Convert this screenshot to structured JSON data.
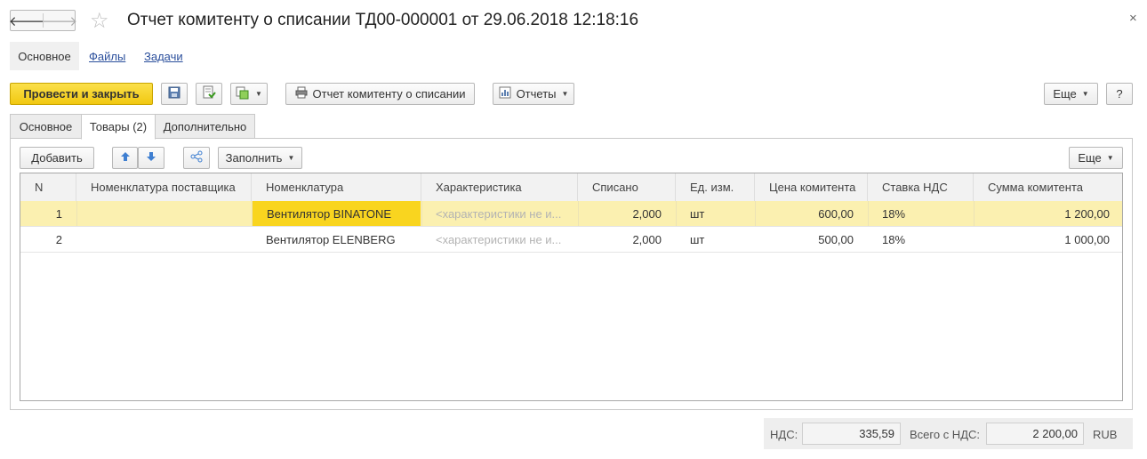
{
  "window": {
    "title": "Отчет комитенту о списании ТД00-000001 от 29.06.2018 12:18:16",
    "back_glyph": "🡐",
    "forward_glyph": "🡒",
    "star_glyph": "☆",
    "close_glyph": "×"
  },
  "sections": {
    "main": "Основное",
    "files": "Файлы",
    "tasks": "Задачи"
  },
  "toolbar": {
    "post_close": "Провести и закрыть",
    "report_button": "Отчет комитенту о списании",
    "reports": "Отчеты",
    "more": "Еще",
    "help": "?"
  },
  "tabs": [
    "Основное",
    "Товары (2)",
    "Дополнительно"
  ],
  "table_toolbar": {
    "add": "Добавить",
    "fill": "Заполнить",
    "more": "Еще"
  },
  "table": {
    "columns": [
      "N",
      "Номенклатура поставщика",
      "Номенклатура",
      "Характеристика",
      "Списано",
      "Ед. изм.",
      "Цена комитента",
      "Ставка НДС",
      "Сумма комитента"
    ],
    "rows": [
      {
        "n": "1",
        "supplier_item": "",
        "item": "Вентилятор BINATONE",
        "characteristic": "<характеристики не и...",
        "written_off": "2,000",
        "unit": "шт",
        "price": "600,00",
        "vat_rate": "18%",
        "sum": "1 200,00"
      },
      {
        "n": "2",
        "supplier_item": "",
        "item": "Вентилятор ELENBERG",
        "characteristic": "<характеристики не и...",
        "written_off": "2,000",
        "unit": "шт",
        "price": "500,00",
        "vat_rate": "18%",
        "sum": "1 000,00"
      }
    ]
  },
  "footer": {
    "vat_label": "НДС:",
    "vat_value": "335,59",
    "total_label": "Всего с НДС:",
    "total_value": "2 200,00",
    "currency": "RUB"
  },
  "colors": {
    "accent_yellow": "#f1c811",
    "selected_row": "#fbf0b0",
    "link_blue": "#2b4f9c"
  }
}
